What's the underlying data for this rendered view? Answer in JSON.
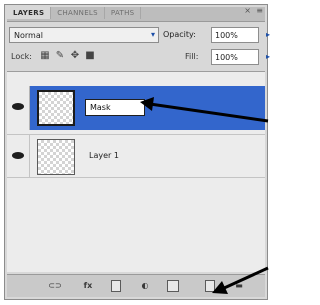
{
  "tabs": [
    {
      "label": "LAYERS",
      "active": true
    },
    {
      "label": "CHANNELS",
      "active": false
    },
    {
      "label": "PATHS",
      "active": false
    }
  ],
  "panel_close": "×",
  "panel_menu": "≡",
  "blend": {
    "value": "Normal"
  },
  "opacity": {
    "label": "Opacity:",
    "value": "100%"
  },
  "lock": {
    "label": "Lock:"
  },
  "fill": {
    "label": "Fill:",
    "value": "100%"
  },
  "layers": [
    {
      "name": "Mask",
      "selected": true,
      "editing": true,
      "visible": true
    },
    {
      "name": "Layer 1",
      "selected": false,
      "editing": false,
      "visible": true
    }
  ],
  "colors": {
    "selection": "#3366cc",
    "panel_bg": "#d8d8d8",
    "list_bg": "#ececec",
    "arrow": "#000000"
  },
  "icons": {
    "lock_transparent": "checkerboard-lock-icon",
    "lock_image": "brush-lock-icon",
    "lock_position": "move-lock-icon",
    "lock_all": "padlock-icon",
    "toolbar": [
      "link-layers-icon",
      "fx-icon",
      "add-mask-icon",
      "adjustment-layer-icon",
      "new-group-icon",
      "new-layer-icon",
      "trash-icon"
    ]
  }
}
